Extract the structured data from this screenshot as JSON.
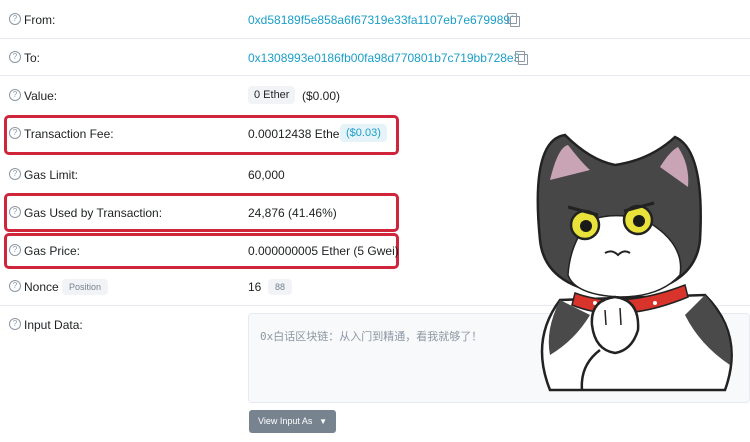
{
  "rows": {
    "from": {
      "label": "From:",
      "value": "0xd58189f5e858a6f67319e33fa1107eb7e679989f"
    },
    "to": {
      "label": "To:",
      "value": "0x1308993e0186fb00fa98d770801b7c719bb728e3"
    },
    "value": {
      "label": "Value:",
      "amount": "0 Ether",
      "usd": "($0.00)"
    },
    "fee": {
      "label": "Transaction Fee:",
      "amount": "0.00012438 Ether",
      "usd": "($0.03)"
    },
    "gas_limit": {
      "label": "Gas Limit:",
      "value": "60,000"
    },
    "gas_used": {
      "label": "Gas Used by Transaction:",
      "value": "24,876 (41.46%)"
    },
    "gas_price": {
      "label": "Gas Price:",
      "value": "0.000000005 Ether (5 Gwei)"
    },
    "nonce": {
      "label": "Nonce",
      "position_label": "Position",
      "value": "16",
      "position": "88"
    },
    "input": {
      "label": "Input Data:",
      "text": "0x白话区块链：从入门到精通，看我就够了！"
    }
  },
  "button": {
    "label": "View Input As"
  },
  "icons": {
    "help": "help-circle-icon",
    "copy": "copy-icon",
    "caret": "caret-down-icon"
  },
  "colors": {
    "link": "#1a9ec9",
    "highlight": "#d0243a",
    "button": "#77838f"
  }
}
